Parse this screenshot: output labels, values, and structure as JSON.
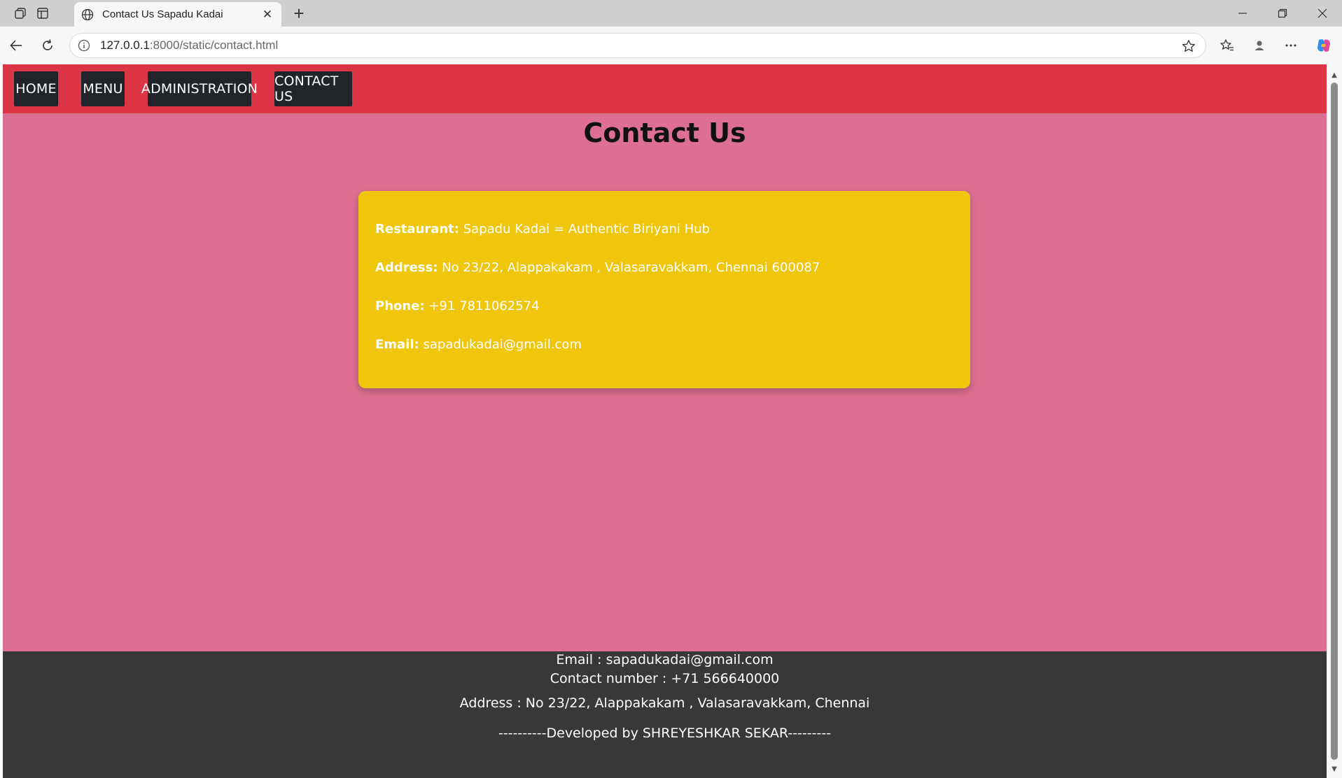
{
  "browser": {
    "tab_title": "Contact Us Sapadu Kadai",
    "url_host": "127.0.0.1",
    "url_path": ":8000/static/contact.html"
  },
  "nav": {
    "items": [
      "HOME",
      "MENU",
      "ADMINISTRATION",
      "CONTACT US"
    ]
  },
  "page": {
    "heading": "Contact Us"
  },
  "contact": {
    "restaurant_label": "Restaurant:",
    "restaurant_value": "Sapadu Kadai = Authentic Biriyani Hub",
    "address_label": "Address:",
    "address_value": "No 23/22, Alappakakam , Valasaravakkam, Chennai 600087",
    "phone_label": "Phone:",
    "phone_value": "+91 7811062574",
    "email_label": "Email:",
    "email_value": "sapadukadai@gmail.com"
  },
  "footer": {
    "email_line": "Email : sapadukadai@gmail.com",
    "contact_line": "Contact number : +71 566640000",
    "address_line": "Address : No 23/22, Alappakakam , Valasaravakkam, Chennai",
    "credit_line": "----------Developed by SHREYESHKAR SEKAR---------"
  },
  "colors": {
    "nav_bar": "#dc3545",
    "nav_button": "#212529",
    "page_background": "#dd7092",
    "card_background": "#f0c60d",
    "footer_background": "#383838"
  },
  "icons": [
    "workspaces-icon",
    "tab-actions-icon",
    "globe-icon",
    "close-icon",
    "new-tab-icon",
    "minimize-icon",
    "restore-icon",
    "window-close-icon",
    "back-icon",
    "refresh-icon",
    "info-icon",
    "favorite-star-icon",
    "favorites-icon",
    "profile-icon",
    "more-icon",
    "copilot-icon"
  ]
}
